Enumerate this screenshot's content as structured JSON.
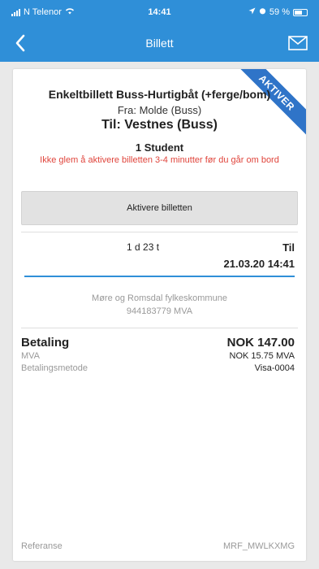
{
  "status_bar": {
    "carrier": "N Telenor",
    "time": "14:41",
    "battery": "59 %"
  },
  "nav": {
    "title": "Billett",
    "back_icon": "chevron-left-icon",
    "mail_icon": "envelope-icon"
  },
  "ticket": {
    "ribbon": "AKTIVER",
    "title": "Enkeltbillett Buss-Hurtigbåt (+ferge/bom)",
    "from": "Fra: Molde (Buss)",
    "to": "Til: Vestnes (Buss)",
    "passenger": "1 Student",
    "warning": "Ikke glem å aktivere billetten 3-4 minutter før du går om bord",
    "activate_label": "Aktivere billetten",
    "duration": "1 d 23 t",
    "valid_label": "Til",
    "valid_date": "21.03.20 14:41",
    "issuer": "Møre og Romsdal fylkeskommune",
    "org_no": "944183779 MVA"
  },
  "payment": {
    "label": "Betaling",
    "amount": "NOK 147.00",
    "vat_label": "MVA",
    "vat_value": "NOK 15.75 MVA",
    "method_label": "Betalingsmetode",
    "method_value": "Visa-0004"
  },
  "reference": {
    "label": "Referanse",
    "value": "MRF_MWLKXMG"
  },
  "colors": {
    "brand": "#2f8fd8",
    "ribbon": "#2f74c8",
    "warning": "#e0453c"
  }
}
